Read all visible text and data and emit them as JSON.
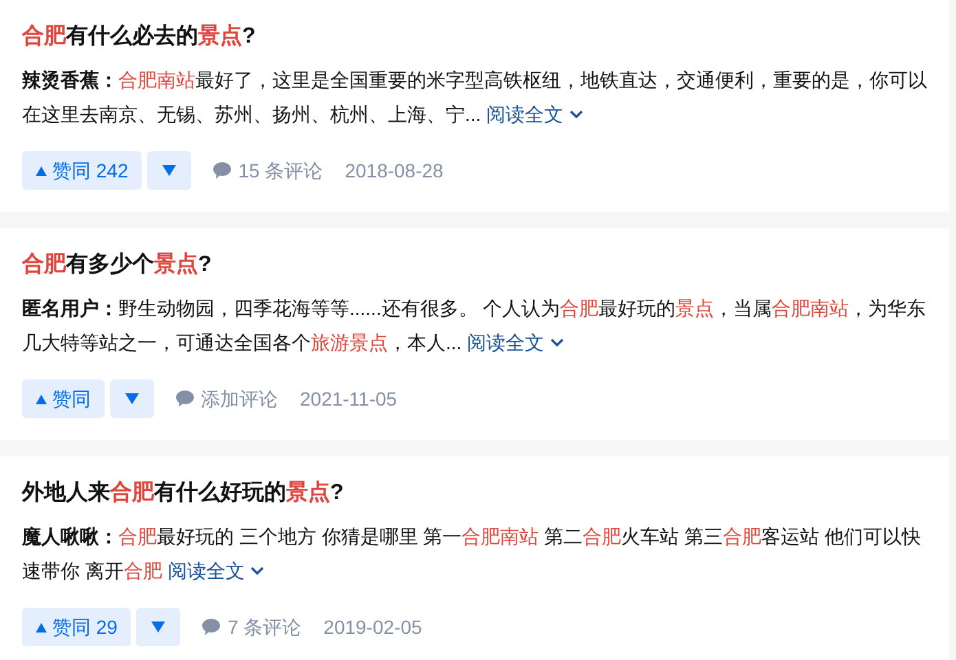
{
  "answers": [
    {
      "title": [
        {
          "text": "合肥",
          "highlight": true
        },
        {
          "text": "有什么必去的",
          "highlight": false
        },
        {
          "text": "景点",
          "highlight": true
        },
        {
          "text": "?",
          "highlight": false
        }
      ],
      "author": "辣烫香蕉：",
      "excerpt": [
        {
          "text": "合肥南站",
          "highlight": true
        },
        {
          "text": "最好了，这里是全国重要的米字型高铁枢纽，地铁直达，交通便利，重要的是，你可以在这里去南京、无锡、苏州、扬州、杭州、上海、宁...",
          "highlight": false
        }
      ],
      "read_more": "阅读全文",
      "upvote": "赞同 242",
      "comments": "15 条评论",
      "date": "2018-08-28"
    },
    {
      "title": [
        {
          "text": "合肥",
          "highlight": true
        },
        {
          "text": "有多少个",
          "highlight": false
        },
        {
          "text": "景点",
          "highlight": true
        },
        {
          "text": "?",
          "highlight": false
        }
      ],
      "author": "匿名用户：",
      "excerpt": [
        {
          "text": "野生动物园，四季花海等等......还有很多。 个人认为",
          "highlight": false
        },
        {
          "text": "合肥",
          "highlight": true
        },
        {
          "text": "最好玩的",
          "highlight": false
        },
        {
          "text": "景点",
          "highlight": true
        },
        {
          "text": "，当属",
          "highlight": false
        },
        {
          "text": "合肥南站",
          "highlight": true
        },
        {
          "text": "，为华东几大特等站之一，可通达全国各个",
          "highlight": false
        },
        {
          "text": "旅游景点",
          "highlight": true
        },
        {
          "text": "，本人...",
          "highlight": false
        }
      ],
      "read_more": "阅读全文",
      "upvote": "赞同",
      "comments": "添加评论",
      "date": "2021-11-05"
    },
    {
      "title": [
        {
          "text": "外地人来",
          "highlight": false
        },
        {
          "text": "合肥",
          "highlight": true
        },
        {
          "text": "有什么好玩的",
          "highlight": false
        },
        {
          "text": "景点",
          "highlight": true
        },
        {
          "text": "?",
          "highlight": false
        }
      ],
      "author": "魔人啾啾：",
      "excerpt": [
        {
          "text": "合肥",
          "highlight": true
        },
        {
          "text": "最好玩的 三个地方 你猜是哪里 第一",
          "highlight": false
        },
        {
          "text": "合肥南站",
          "highlight": true
        },
        {
          "text": " 第二",
          "highlight": false
        },
        {
          "text": "合肥",
          "highlight": true
        },
        {
          "text": "火车站 第三",
          "highlight": false
        },
        {
          "text": "合肥",
          "highlight": true
        },
        {
          "text": "客运站 他们可以快速带你 离开",
          "highlight": false
        },
        {
          "text": "合肥",
          "highlight": true
        }
      ],
      "read_more": "阅读全文",
      "upvote": "赞同 29",
      "comments": "7 条评论",
      "date": "2019-02-05"
    }
  ]
}
